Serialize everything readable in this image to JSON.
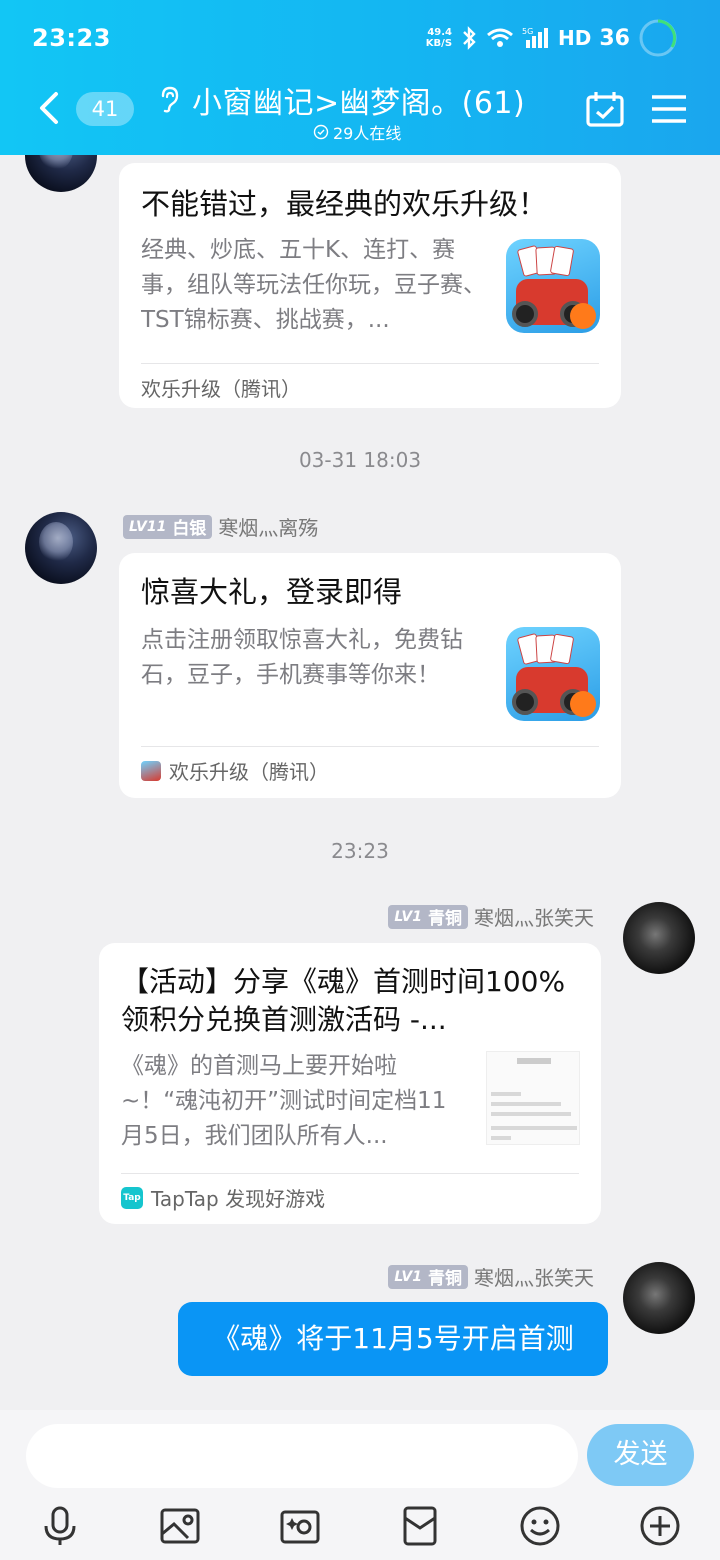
{
  "status_bar": {
    "time": "23:23",
    "net_speed_top": "49.4",
    "net_speed_bottom": "KB/S",
    "hd": "HD",
    "battery": "36"
  },
  "header": {
    "unread_count": "41",
    "group_title": "小窗幽记>幽梦阁。(61)",
    "online_text": "29人在线"
  },
  "messages": {
    "card1": {
      "title": "不能错过，最经典的欢乐升级！",
      "desc": "经典、炒底、五十K、连打、赛事，组队等玩法任你玩，豆子赛、TST锦标赛、挑战赛，...",
      "source": "欢乐升级（腾讯）"
    },
    "time1": "03-31 18:03",
    "msg2": {
      "level": "LV11",
      "rank": "白银",
      "nickname": "寒烟灬离殇",
      "title": "惊喜大礼，登录即得",
      "desc": "点击注册领取惊喜大礼，免费钻石，豆子，手机赛事等你来！",
      "source": "欢乐升级（腾讯）"
    },
    "time2": "23:23",
    "msg3": {
      "level": "LV1",
      "rank": "青铜",
      "nickname": "寒烟灬张笑天",
      "title": "【活动】分享《魂》首测时间100%领积分兑换首测激活码 -...",
      "desc": "《魂》的首测马上要开始啦~！“魂沌初开”测试时间定档11月5日，我们团队所有人...",
      "source": "TapTap 发现好游戏",
      "tap_logo_text": "Tap"
    },
    "msg4": {
      "level": "LV1",
      "rank": "青铜",
      "nickname": "寒烟灬张笑天",
      "text": "《魂》将于11月5号开启首测"
    }
  },
  "input": {
    "placeholder": "",
    "send_label": "发送"
  },
  "colors": {
    "header_gradient_start": "#12c6f5",
    "header_gradient_end": "#1aa6ee",
    "bubble_blue": "#0a95f5",
    "send_button": "#7ec9f5",
    "chat_background": "#f0f0f2"
  }
}
